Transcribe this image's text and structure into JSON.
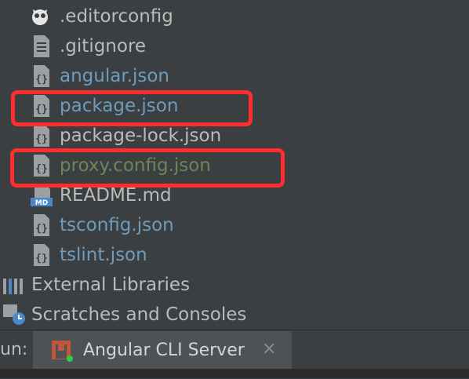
{
  "project_tree": {
    "files": [
      {
        "label": ".editorconfig",
        "icon": "editorconfig-icon",
        "color": "#bbbbbb"
      },
      {
        "label": ".gitignore",
        "icon": "text-file-icon",
        "color": "#bbbbbb"
      },
      {
        "label": "angular.json",
        "icon": "json-file-icon",
        "color": "#6d9cbe"
      },
      {
        "label": "package.json",
        "icon": "json-file-icon",
        "color": "#6d9cbe"
      },
      {
        "label": "package-lock.json",
        "icon": "json-file-icon",
        "color": "#bbbbbb"
      },
      {
        "label": "proxy.config.json",
        "icon": "json-file-icon",
        "color": "#6a8759"
      },
      {
        "label": "README.md",
        "icon": "markdown-file-icon",
        "color": "#bbbbbb"
      },
      {
        "label": "tsconfig.json",
        "icon": "json-file-icon",
        "color": "#6d9cbe"
      },
      {
        "label": "tslint.json",
        "icon": "json-file-icon",
        "color": "#6d9cbe"
      }
    ],
    "external_libraries": "External Libraries",
    "scratches": "Scratches and Consoles"
  },
  "markdown_badge": "MD",
  "json_badge": "{}",
  "run_bar": {
    "label": "un:",
    "tab_title": "Angular CLI Server",
    "close_glyph": "×"
  },
  "annotations": {
    "highlight_color": "#ff2d2d"
  }
}
